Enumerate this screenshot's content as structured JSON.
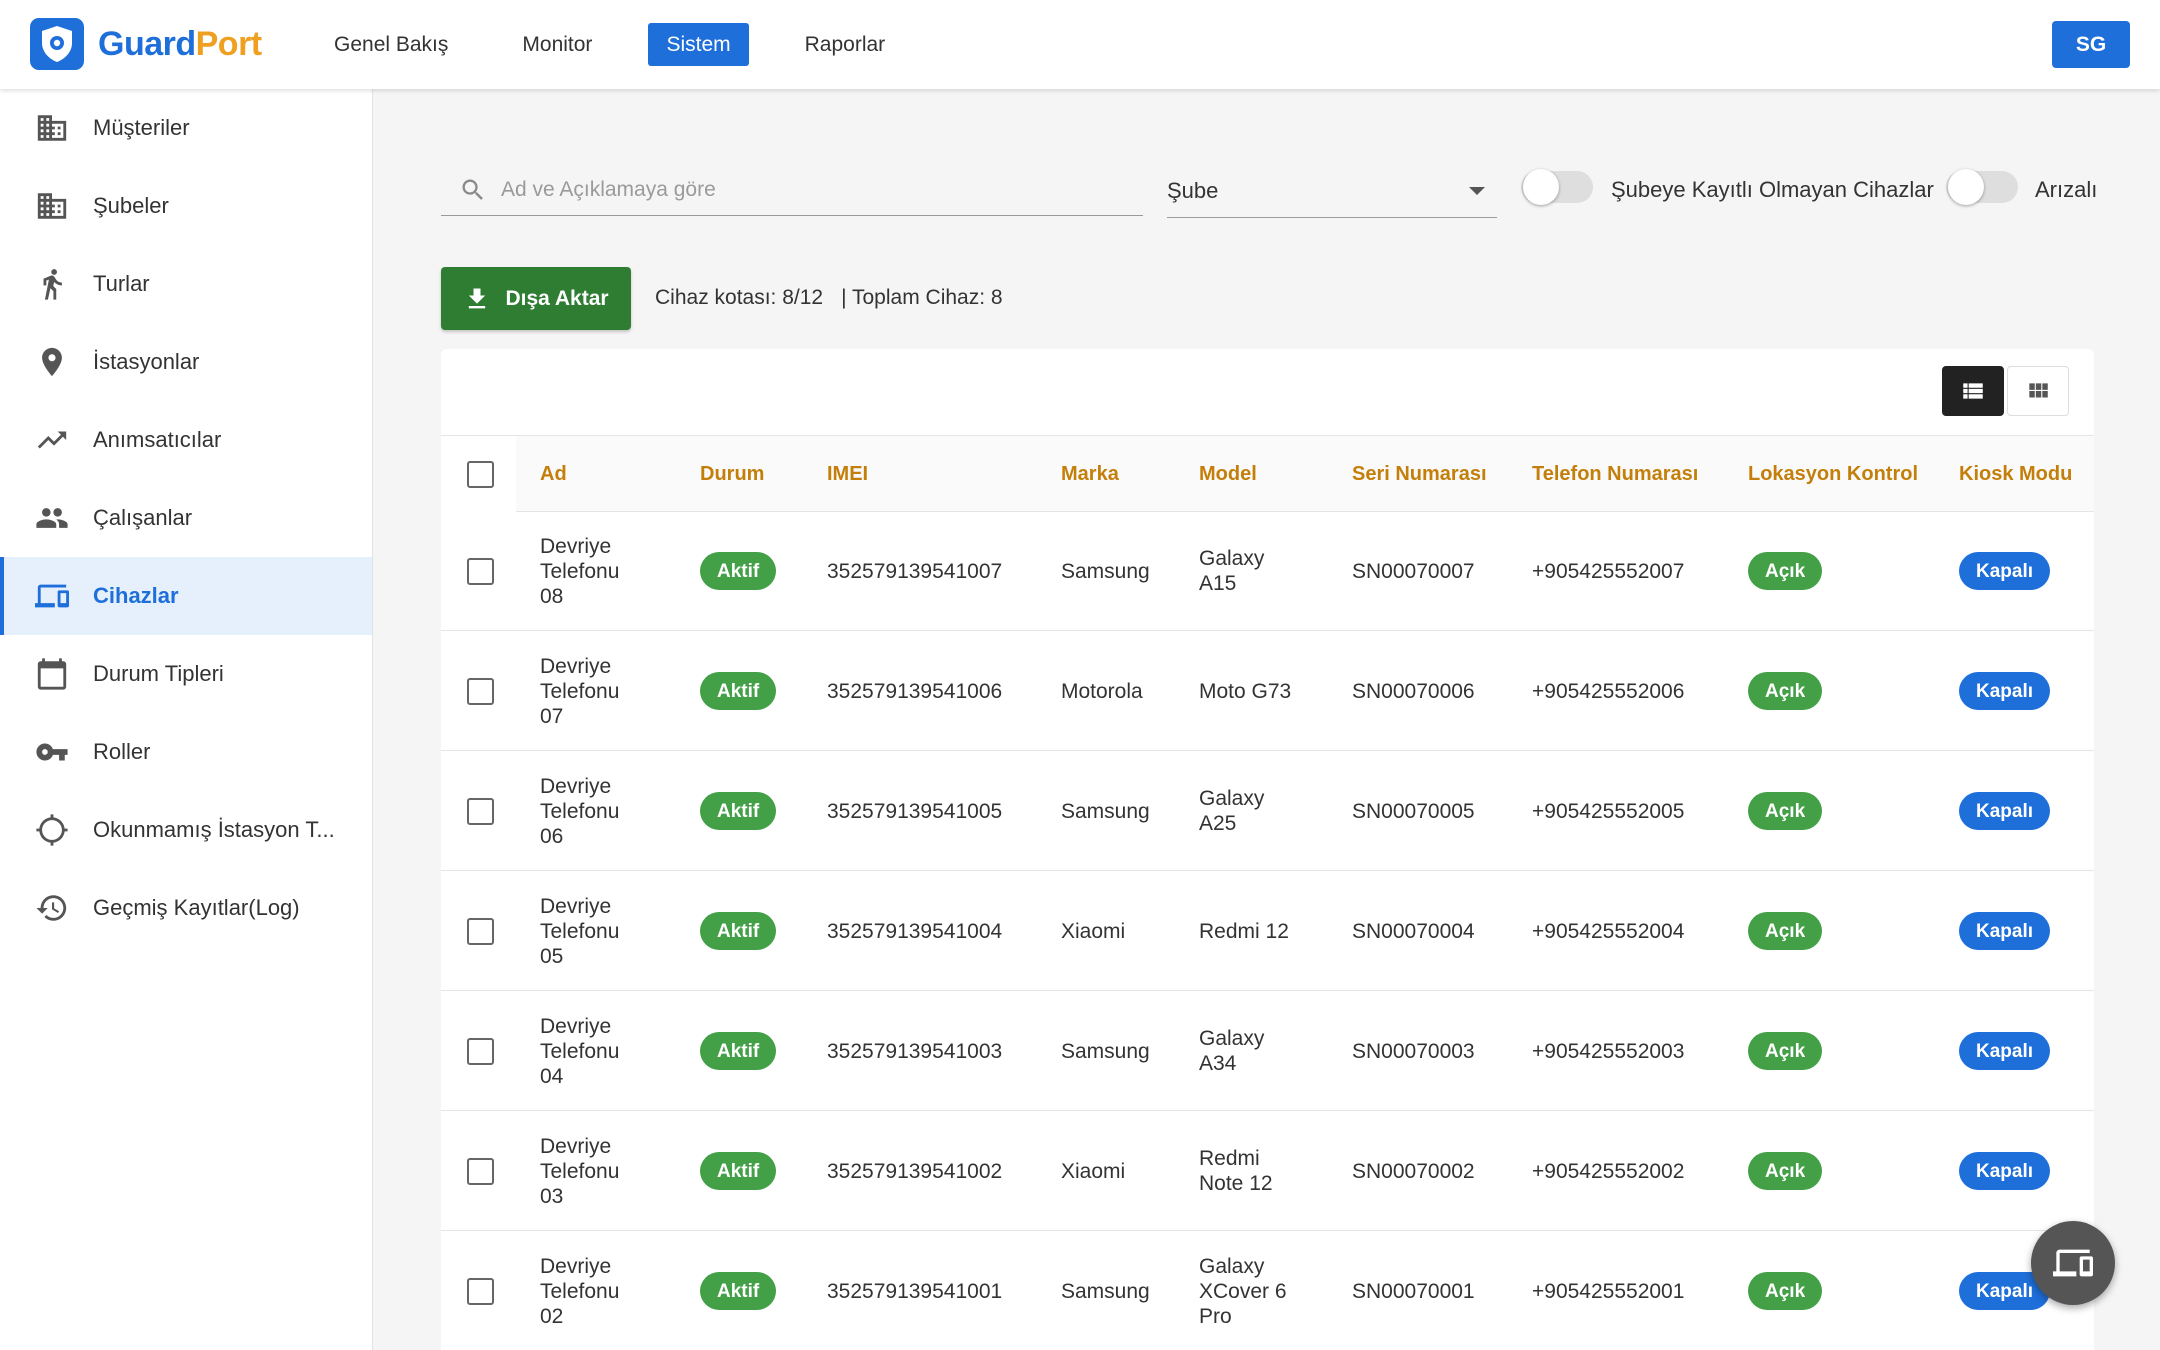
{
  "app": {
    "brand_part1": "Guard",
    "brand_part2": "Port",
    "avatar_initials": "SG"
  },
  "nav": {
    "items": [
      "Genel Bakış",
      "Monitor",
      "Sistem",
      "Raporlar"
    ],
    "active": "Sistem"
  },
  "sidebar": {
    "items": [
      {
        "label": "Müşteriler",
        "icon": "building-icon"
      },
      {
        "label": "Şubeler",
        "icon": "building-icon"
      },
      {
        "label": "Turlar",
        "icon": "walking-person-icon"
      },
      {
        "label": "İstasyonlar",
        "icon": "location-pin-icon"
      },
      {
        "label": "Anımsatıcılar",
        "icon": "trending-up-icon"
      },
      {
        "label": "Çalışanlar",
        "icon": "people-icon"
      },
      {
        "label": "Cihazlar",
        "icon": "devices-icon"
      },
      {
        "label": "Durum Tipleri",
        "icon": "calendar-icon"
      },
      {
        "label": "Roller",
        "icon": "key-icon"
      },
      {
        "label": "Okunmamış İstasyon T...",
        "icon": "crosshair-icon"
      },
      {
        "label": "Geçmiş Kayıtlar(Log)",
        "icon": "history-icon"
      }
    ],
    "active": "Cihazlar"
  },
  "filters": {
    "search_placeholder": "Ad ve Açıklamaya göre",
    "branch_label": "Şube",
    "toggle_unregistered_label": "Şubeye Kayıtlı Olmayan Cihazlar",
    "toggle_faulty_label": "Arızalı"
  },
  "toolbar": {
    "export_label": "Dışa Aktar",
    "quota_text": "Cihaz kotası: 8/12",
    "total_text": "| Toplam Cihaz: 8"
  },
  "table": {
    "columns": [
      "Ad",
      "Durum",
      "IMEI",
      "Marka",
      "Model",
      "Seri Numarası",
      "Telefon Numarası",
      "Lokasyon Kontrol",
      "Kiosk Modu"
    ],
    "rows": [
      {
        "name": [
          "Devriye",
          "Telefonu",
          "08"
        ],
        "status": "Aktif",
        "imei": "352579139541007",
        "brand": "Samsung",
        "model": [
          "Galaxy",
          "A15"
        ],
        "serial": "SN00070007",
        "phone": "+905425552007",
        "location": "Açık",
        "kiosk": "Kapalı"
      },
      {
        "name": [
          "Devriye",
          "Telefonu",
          "07"
        ],
        "status": "Aktif",
        "imei": "352579139541006",
        "brand": "Motorola",
        "model": [
          "Moto G73"
        ],
        "serial": "SN00070006",
        "phone": "+905425552006",
        "location": "Açık",
        "kiosk": "Kapalı"
      },
      {
        "name": [
          "Devriye",
          "Telefonu",
          "06"
        ],
        "status": "Aktif",
        "imei": "352579139541005",
        "brand": "Samsung",
        "model": [
          "Galaxy",
          "A25"
        ],
        "serial": "SN00070005",
        "phone": "+905425552005",
        "location": "Açık",
        "kiosk": "Kapalı"
      },
      {
        "name": [
          "Devriye",
          "Telefonu",
          "05"
        ],
        "status": "Aktif",
        "imei": "352579139541004",
        "brand": "Xiaomi",
        "model": [
          "Redmi 12"
        ],
        "serial": "SN00070004",
        "phone": "+905425552004",
        "location": "Açık",
        "kiosk": "Kapalı"
      },
      {
        "name": [
          "Devriye",
          "Telefonu",
          "04"
        ],
        "status": "Aktif",
        "imei": "352579139541003",
        "brand": "Samsung",
        "model": [
          "Galaxy",
          "A34"
        ],
        "serial": "SN00070003",
        "phone": "+905425552003",
        "location": "Açık",
        "kiosk": "Kapalı"
      },
      {
        "name": [
          "Devriye",
          "Telefonu",
          "03"
        ],
        "status": "Aktif",
        "imei": "352579139541002",
        "brand": "Xiaomi",
        "model": [
          "Redmi",
          "Note 12"
        ],
        "serial": "SN00070002",
        "phone": "+905425552002",
        "location": "Açık",
        "kiosk": "Kapalı"
      },
      {
        "name": [
          "Devriye",
          "Telefonu",
          "02"
        ],
        "status": "Aktif",
        "imei": "352579139541001",
        "brand": "Samsung",
        "model": [
          "Galaxy",
          "XCover 6",
          "Pro"
        ],
        "serial": "SN00070001",
        "phone": "+905425552001",
        "location": "Açık",
        "kiosk": "Kapalı"
      }
    ]
  },
  "colors": {
    "primary": "#1e6fd9",
    "accent": "#f0a020",
    "export_green": "#2e7d32",
    "status_green": "#43a047",
    "header_text": "#c47f0a"
  },
  "fab": {
    "icon": "devices-icon"
  }
}
